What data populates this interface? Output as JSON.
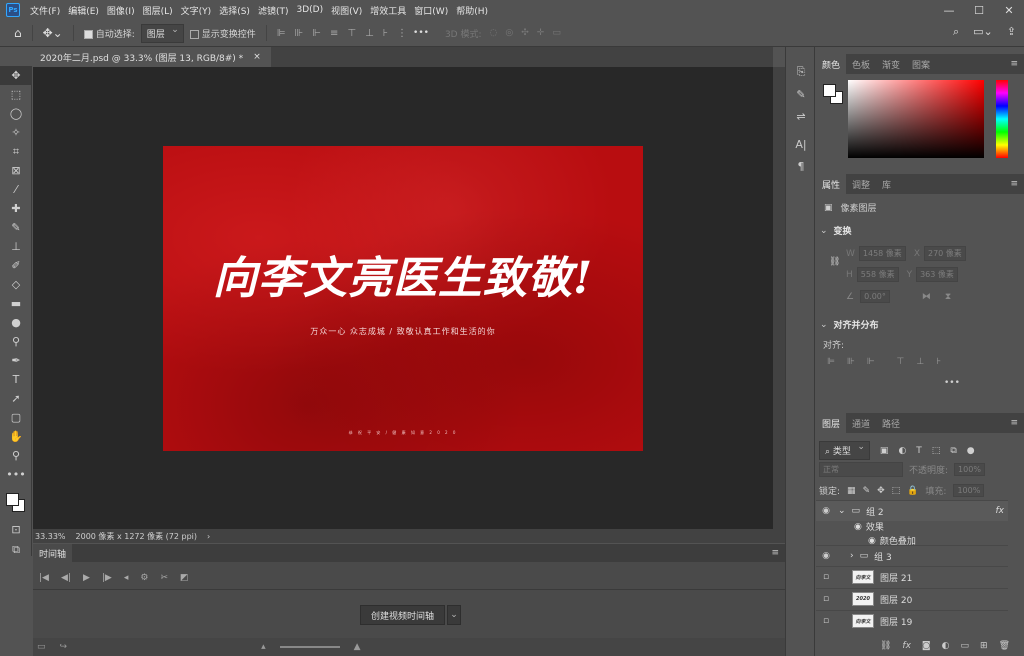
{
  "menubar": {
    "logo": "Ps",
    "items": [
      "文件(F)",
      "编辑(E)",
      "图像(I)",
      "图层(L)",
      "文字(Y)",
      "选择(S)",
      "滤镜(T)",
      "3D(D)",
      "视图(V)",
      "增效工具",
      "窗口(W)",
      "帮助(H)"
    ],
    "window_controls": [
      "—",
      "☐",
      "✕"
    ]
  },
  "options": {
    "auto_select_label": "自动选择:",
    "auto_select_value": "图层",
    "show_transform_label": "显示变换控件",
    "more": "•••",
    "mode3d_label": "3D 模式:"
  },
  "document": {
    "tab_title": "2020年二月.psd @ 33.3% (图层 13, RGB/8#) *",
    "close": "×",
    "zoom": "33.33%",
    "size_info": "2000 像素 x 1272 像素 (72 ppi)",
    "status_arrow": "›"
  },
  "poster": {
    "headline": "向李文亮医生致敬!",
    "subline": "万众一心  众志成城  /    致敬认真工作和生活的你",
    "footer": "恭 祝 平 安 / 健 康 如 意   2 0 2 0"
  },
  "timeline": {
    "tab": "时间轴",
    "create_button": "创建视频时间轴"
  },
  "color_panel": {
    "tabs": [
      "颜色",
      "色板",
      "渐变",
      "图案"
    ]
  },
  "properties_panel": {
    "tabs": [
      "属性",
      "调整",
      "库"
    ],
    "layer_type": "像素图层",
    "transform_title": "变换",
    "w_label": "W",
    "w_value": "1458 像素",
    "x_label": "X",
    "x_value": "270 像素",
    "h_label": "H",
    "h_value": "558 像素",
    "y_label": "Y",
    "y_value": "363 像素",
    "angle_value": "0.00°",
    "align_title": "对齐并分布",
    "align_label": "对齐:",
    "more": "•••"
  },
  "layers_panel": {
    "tabs": [
      "图层",
      "通道",
      "路径"
    ],
    "filter_label": "类型",
    "blend_mode": "正常",
    "opacity_label": "不透明度:",
    "opacity_value": "100%",
    "lock_label": "锁定:",
    "fill_label": "填充:",
    "fill_value": "100%",
    "fx": "fx",
    "layers": [
      {
        "name": "组 2",
        "type": "group"
      },
      {
        "name": "效果",
        "type": "effects"
      },
      {
        "name": "颜色叠加",
        "type": "effect"
      },
      {
        "name": "组 3",
        "type": "group"
      },
      {
        "name": "图层 21",
        "type": "pixel"
      },
      {
        "name": "图层 20",
        "type": "pixel"
      },
      {
        "name": "图层 19",
        "type": "pixel"
      }
    ]
  }
}
